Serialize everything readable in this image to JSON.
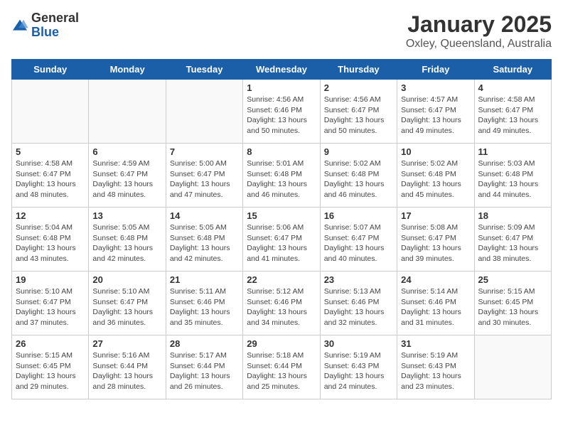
{
  "header": {
    "logo_general": "General",
    "logo_blue": "Blue",
    "title": "January 2025",
    "subtitle": "Oxley, Queensland, Australia"
  },
  "weekdays": [
    "Sunday",
    "Monday",
    "Tuesday",
    "Wednesday",
    "Thursday",
    "Friday",
    "Saturday"
  ],
  "weeks": [
    [
      {
        "day": "",
        "info": ""
      },
      {
        "day": "",
        "info": ""
      },
      {
        "day": "",
        "info": ""
      },
      {
        "day": "1",
        "info": "Sunrise: 4:56 AM\nSunset: 6:46 PM\nDaylight: 13 hours\nand 50 minutes."
      },
      {
        "day": "2",
        "info": "Sunrise: 4:56 AM\nSunset: 6:47 PM\nDaylight: 13 hours\nand 50 minutes."
      },
      {
        "day": "3",
        "info": "Sunrise: 4:57 AM\nSunset: 6:47 PM\nDaylight: 13 hours\nand 49 minutes."
      },
      {
        "day": "4",
        "info": "Sunrise: 4:58 AM\nSunset: 6:47 PM\nDaylight: 13 hours\nand 49 minutes."
      }
    ],
    [
      {
        "day": "5",
        "info": "Sunrise: 4:58 AM\nSunset: 6:47 PM\nDaylight: 13 hours\nand 48 minutes."
      },
      {
        "day": "6",
        "info": "Sunrise: 4:59 AM\nSunset: 6:47 PM\nDaylight: 13 hours\nand 48 minutes."
      },
      {
        "day": "7",
        "info": "Sunrise: 5:00 AM\nSunset: 6:47 PM\nDaylight: 13 hours\nand 47 minutes."
      },
      {
        "day": "8",
        "info": "Sunrise: 5:01 AM\nSunset: 6:48 PM\nDaylight: 13 hours\nand 46 minutes."
      },
      {
        "day": "9",
        "info": "Sunrise: 5:02 AM\nSunset: 6:48 PM\nDaylight: 13 hours\nand 46 minutes."
      },
      {
        "day": "10",
        "info": "Sunrise: 5:02 AM\nSunset: 6:48 PM\nDaylight: 13 hours\nand 45 minutes."
      },
      {
        "day": "11",
        "info": "Sunrise: 5:03 AM\nSunset: 6:48 PM\nDaylight: 13 hours\nand 44 minutes."
      }
    ],
    [
      {
        "day": "12",
        "info": "Sunrise: 5:04 AM\nSunset: 6:48 PM\nDaylight: 13 hours\nand 43 minutes."
      },
      {
        "day": "13",
        "info": "Sunrise: 5:05 AM\nSunset: 6:48 PM\nDaylight: 13 hours\nand 42 minutes."
      },
      {
        "day": "14",
        "info": "Sunrise: 5:05 AM\nSunset: 6:48 PM\nDaylight: 13 hours\nand 42 minutes."
      },
      {
        "day": "15",
        "info": "Sunrise: 5:06 AM\nSunset: 6:47 PM\nDaylight: 13 hours\nand 41 minutes."
      },
      {
        "day": "16",
        "info": "Sunrise: 5:07 AM\nSunset: 6:47 PM\nDaylight: 13 hours\nand 40 minutes."
      },
      {
        "day": "17",
        "info": "Sunrise: 5:08 AM\nSunset: 6:47 PM\nDaylight: 13 hours\nand 39 minutes."
      },
      {
        "day": "18",
        "info": "Sunrise: 5:09 AM\nSunset: 6:47 PM\nDaylight: 13 hours\nand 38 minutes."
      }
    ],
    [
      {
        "day": "19",
        "info": "Sunrise: 5:10 AM\nSunset: 6:47 PM\nDaylight: 13 hours\nand 37 minutes."
      },
      {
        "day": "20",
        "info": "Sunrise: 5:10 AM\nSunset: 6:47 PM\nDaylight: 13 hours\nand 36 minutes."
      },
      {
        "day": "21",
        "info": "Sunrise: 5:11 AM\nSunset: 6:46 PM\nDaylight: 13 hours\nand 35 minutes."
      },
      {
        "day": "22",
        "info": "Sunrise: 5:12 AM\nSunset: 6:46 PM\nDaylight: 13 hours\nand 34 minutes."
      },
      {
        "day": "23",
        "info": "Sunrise: 5:13 AM\nSunset: 6:46 PM\nDaylight: 13 hours\nand 32 minutes."
      },
      {
        "day": "24",
        "info": "Sunrise: 5:14 AM\nSunset: 6:46 PM\nDaylight: 13 hours\nand 31 minutes."
      },
      {
        "day": "25",
        "info": "Sunrise: 5:15 AM\nSunset: 6:45 PM\nDaylight: 13 hours\nand 30 minutes."
      }
    ],
    [
      {
        "day": "26",
        "info": "Sunrise: 5:15 AM\nSunset: 6:45 PM\nDaylight: 13 hours\nand 29 minutes."
      },
      {
        "day": "27",
        "info": "Sunrise: 5:16 AM\nSunset: 6:44 PM\nDaylight: 13 hours\nand 28 minutes."
      },
      {
        "day": "28",
        "info": "Sunrise: 5:17 AM\nSunset: 6:44 PM\nDaylight: 13 hours\nand 26 minutes."
      },
      {
        "day": "29",
        "info": "Sunrise: 5:18 AM\nSunset: 6:44 PM\nDaylight: 13 hours\nand 25 minutes."
      },
      {
        "day": "30",
        "info": "Sunrise: 5:19 AM\nSunset: 6:43 PM\nDaylight: 13 hours\nand 24 minutes."
      },
      {
        "day": "31",
        "info": "Sunrise: 5:19 AM\nSunset: 6:43 PM\nDaylight: 13 hours\nand 23 minutes."
      },
      {
        "day": "",
        "info": ""
      }
    ]
  ]
}
